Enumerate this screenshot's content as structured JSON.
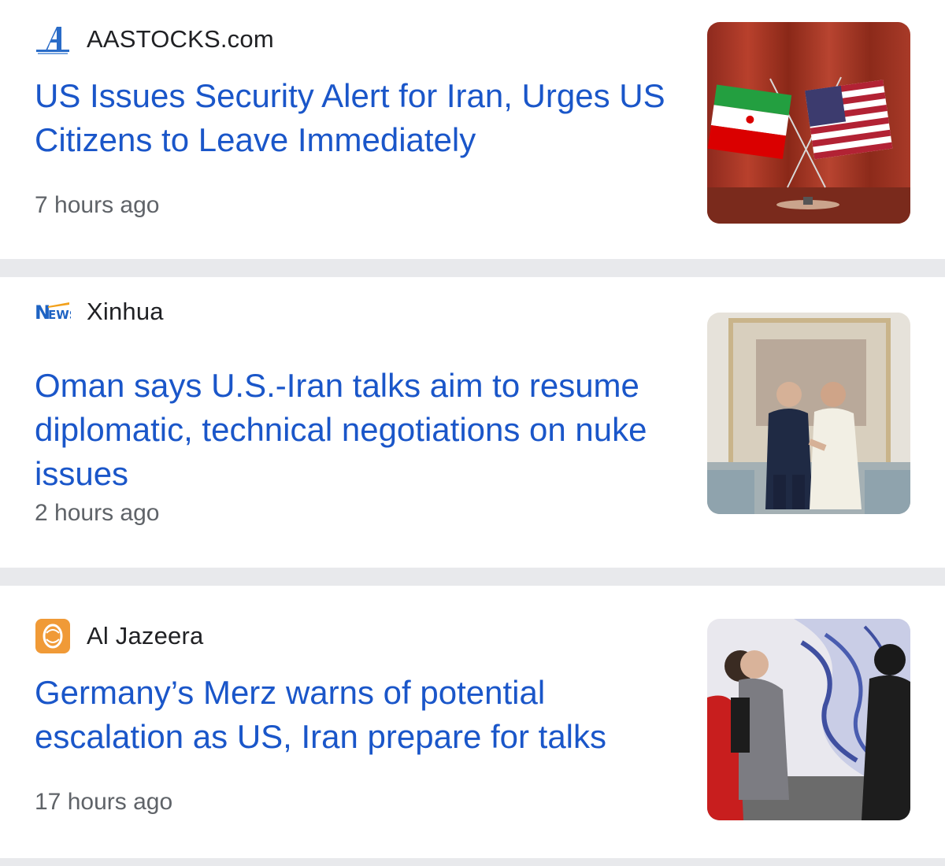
{
  "articles": [
    {
      "source": "AASTOCKS.com",
      "source_icon": "aastocks-logo-icon",
      "headline": "US Issues Security Alert for Iran, Urges US Citizens to Leave Immediately",
      "time": "7 hours ago",
      "thumbnail": "iran-us-flags-image"
    },
    {
      "source": "Xinhua",
      "source_icon": "xinhua-news-logo-icon",
      "headline": "Oman says U.S.-Iran talks aim to resume diplomatic, technical negotiations on nuke issues",
      "time": "2 hours ago",
      "thumbnail": "diplomats-handshake-image"
    },
    {
      "source": "Al Jazeera",
      "source_icon": "al-jazeera-logo-icon",
      "headline": "Germany’s Merz warns of potential escalation as US, Iran prepare for talks",
      "time": "17 hours ago",
      "thumbnail": "street-mural-pedestrians-image"
    }
  ],
  "colors": {
    "headline": "#1a56c9",
    "source_text": "#202124",
    "time_text": "#5f6368",
    "divider": "#e8e9ec"
  }
}
